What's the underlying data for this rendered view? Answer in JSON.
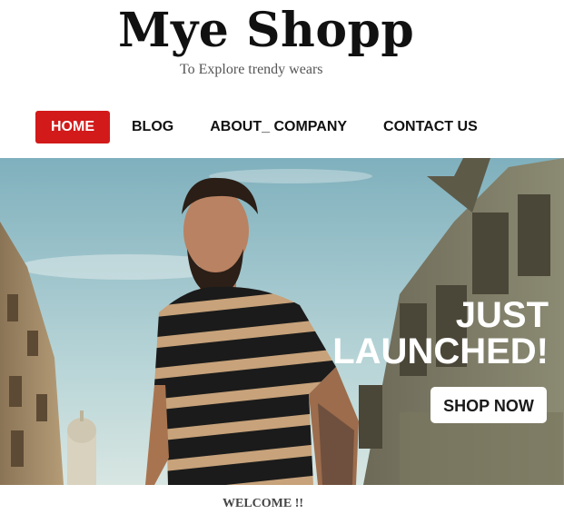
{
  "brand": {
    "title": "Mye Shopp",
    "tagline": "To Explore trendy wears"
  },
  "nav": {
    "items": [
      {
        "label": "HOME",
        "active": true
      },
      {
        "label": "BLOG",
        "active": false
      },
      {
        "label": "ABOUT_ COMPANY",
        "active": false
      },
      {
        "label": "CONTACT US",
        "active": false
      }
    ]
  },
  "hero": {
    "headline_line1": "JUST",
    "headline_line2": "LAUNCHED!",
    "cta_label": "SHOP NOW"
  },
  "welcome_text": "WELCOME !!",
  "colors": {
    "nav_active": "#d21a1a",
    "sky": "#9fc3c9",
    "shirt_stripe_dark": "#1a1a1a",
    "shirt_stripe_light": "#c6a17a"
  }
}
